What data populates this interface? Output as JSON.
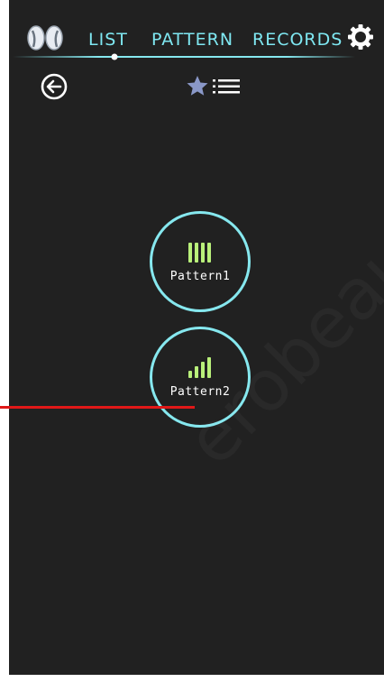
{
  "colors": {
    "background": "#212121",
    "accent": "#86e8ef",
    "bar_green": "#b9f07a",
    "star": "#8a98c8",
    "annotation": "#e01818"
  },
  "header": {
    "icon": "earbuds-icon",
    "tabs": [
      {
        "label": "LIST"
      },
      {
        "label": "PATTERN"
      },
      {
        "label": "RECORDS"
      }
    ],
    "settings_icon": "gear-icon"
  },
  "toolbar": {
    "back_icon": "back-arrow-icon",
    "favorites_icon": "star-list-icon"
  },
  "patterns": [
    {
      "label": "Pattern1",
      "icon": "equal-bars-icon"
    },
    {
      "label": "Pattern2",
      "icon": "ascending-bars-icon"
    }
  ],
  "watermark": {
    "text": "erobeaut"
  }
}
